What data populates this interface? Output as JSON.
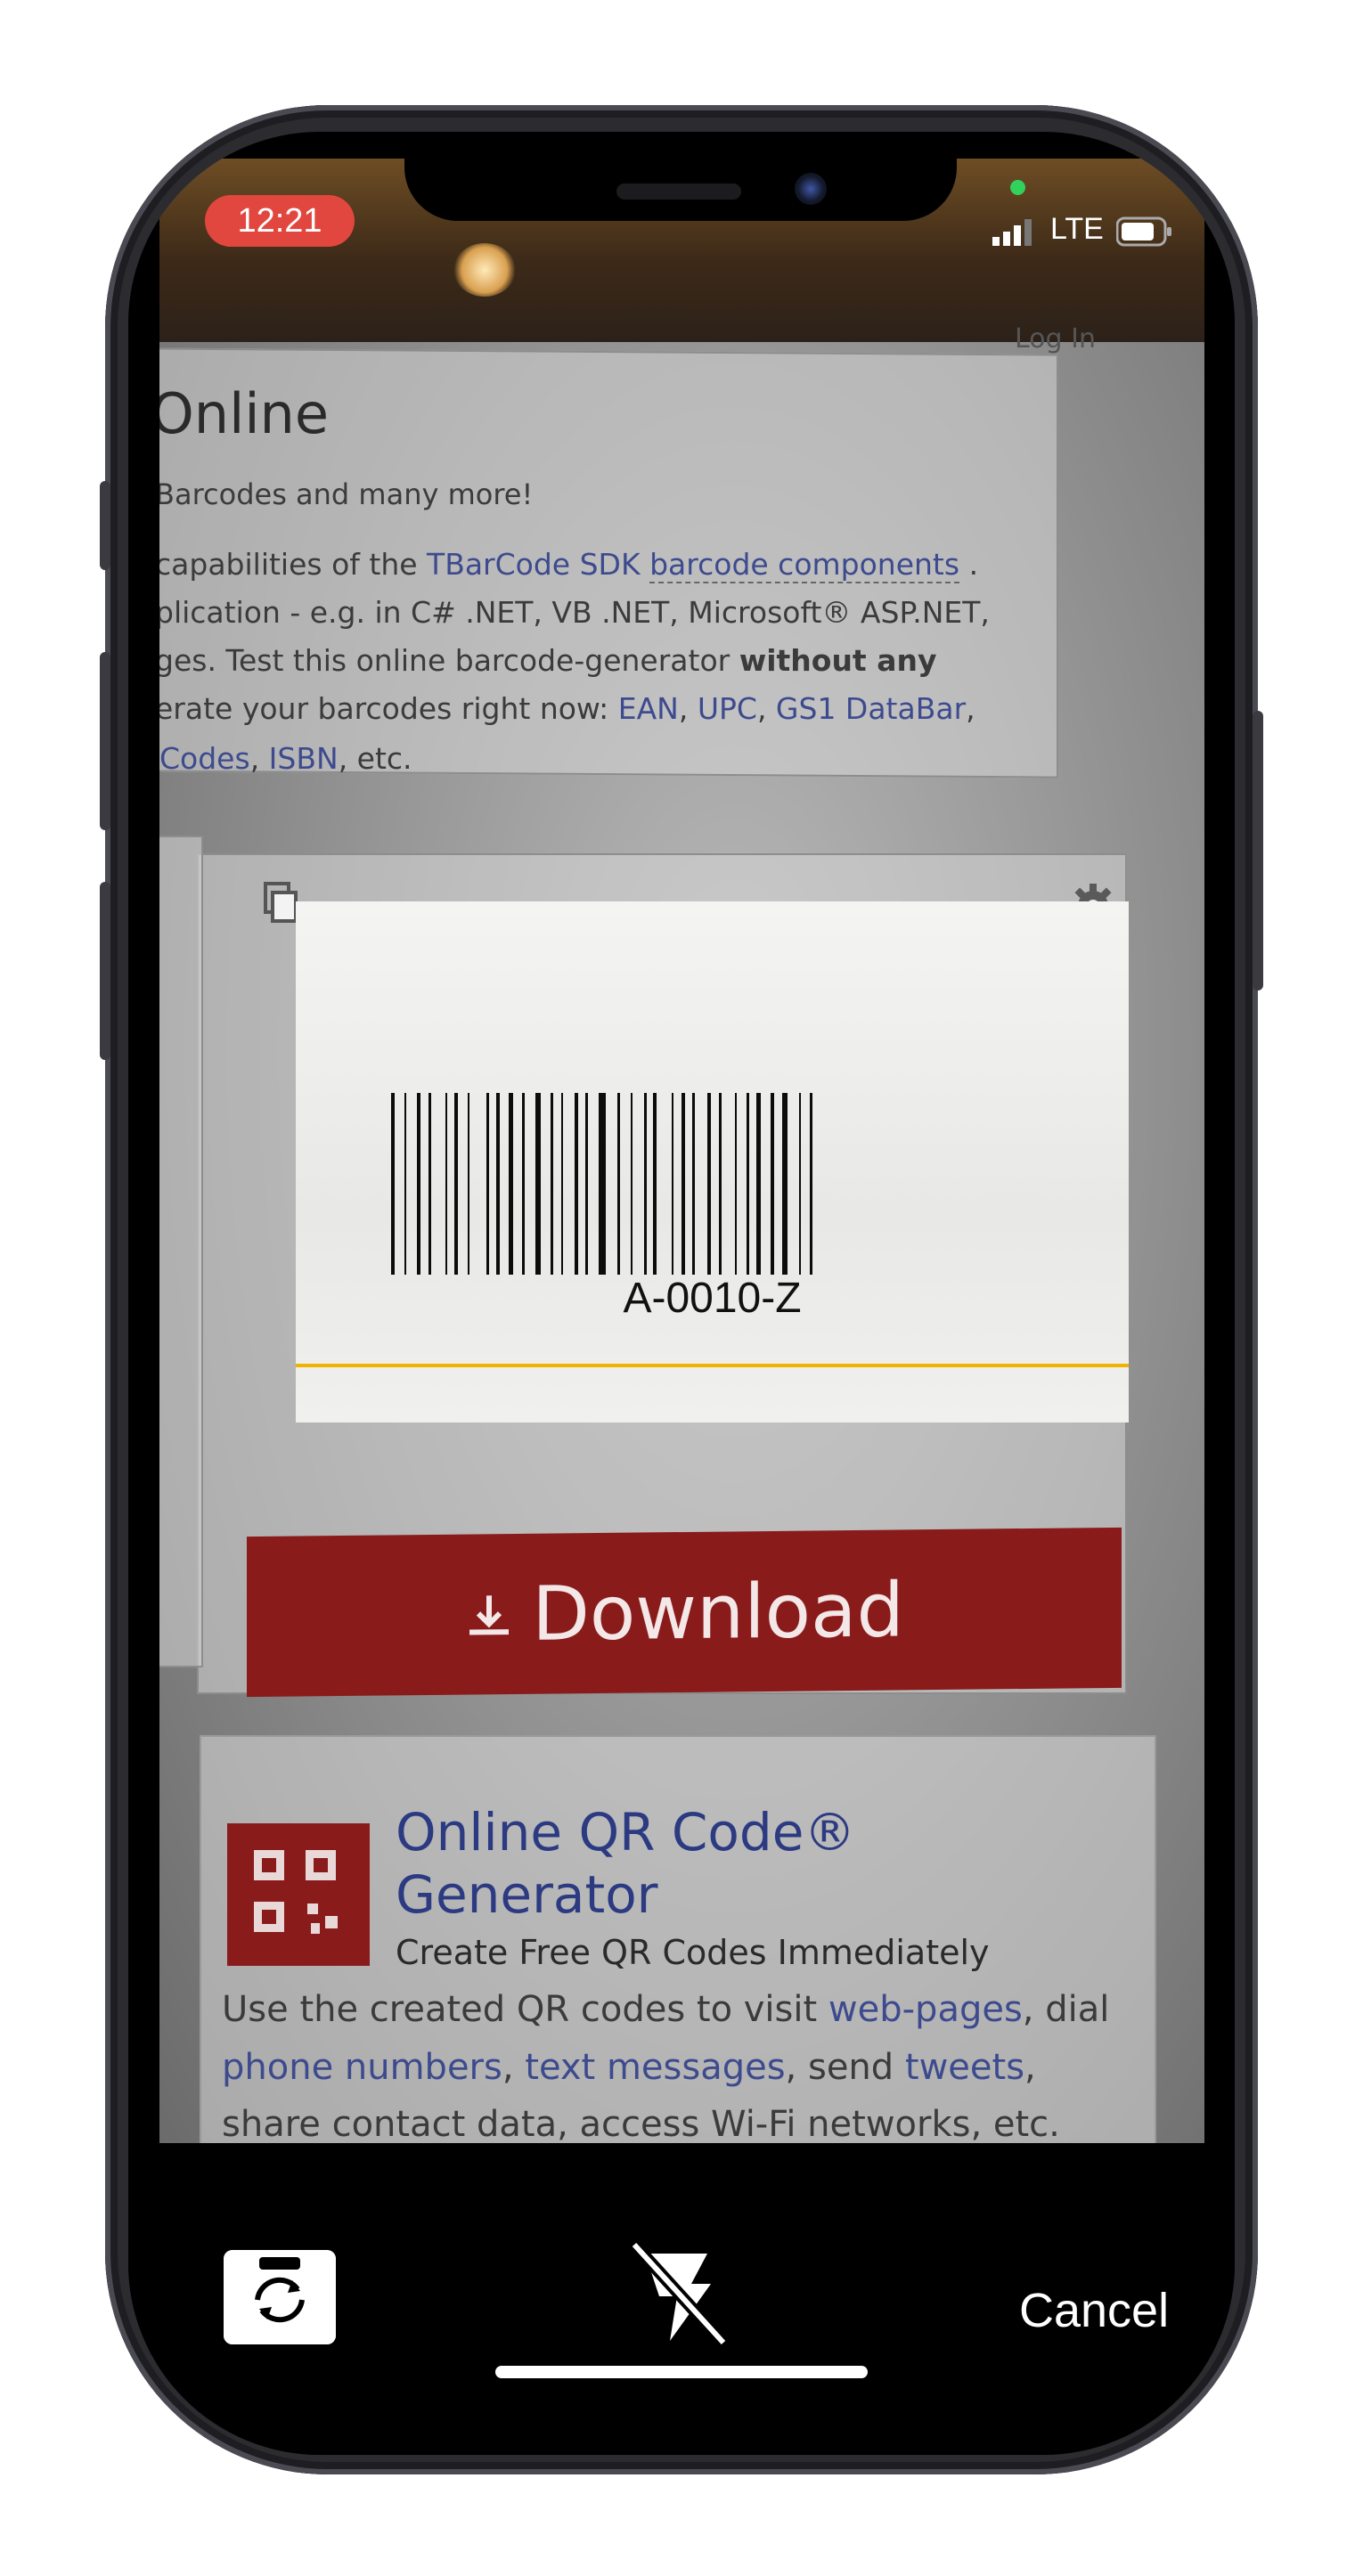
{
  "status_bar": {
    "time": "12:21",
    "network": "LTE"
  },
  "background_page": {
    "login": "Log In",
    "heading": "Online",
    "subheading": "Barcodes and many more!",
    "para_line1_a": "capabilities of the ",
    "para_line1_link1": "TBarCode SDK",
    "para_line1_link2": "barcode components",
    "para_line1_b": ".",
    "para_line2": "plication - e.g. in C# .NET, VB .NET, Microsoft® ASP.NET,",
    "para_line3_a": "ges. Test this online barcode-generator ",
    "para_line3_b": "without any",
    "para_line4_a": "erate your barcodes right now: ",
    "para_line4_link1": "EAN",
    "para_line4_link2": "UPC",
    "para_line4_link3": "GS1 DataBar",
    "para_line5_link1": "Codes",
    "para_line5_link2": "ISBN",
    "para_line5_b": ", etc.",
    "download_label": "Download",
    "qr_title_line1": "Online QR Code®",
    "qr_title_line2": "Generator",
    "qr_subtitle": "Create Free QR Codes Immediately",
    "qr_body1_a": "Use the created QR codes to visit ",
    "qr_body1_link": "web-pages",
    "qr_body1_b": ", dial",
    "qr_body2_link1": "phone numbers",
    "qr_body2_link2": "text messages",
    "qr_body2_b": ", send ",
    "qr_body2_link3": "tweets",
    "qr_body2_c": ",",
    "qr_body3": "share contact data, access Wi-Fi networks, etc."
  },
  "scan": {
    "barcode_text": "A-0010-Z"
  },
  "controls": {
    "cancel_label": "Cancel",
    "flip_camera_icon": "camera-rotate-icon",
    "flash_off_icon": "flash-off-icon"
  },
  "colors": {
    "time_pill": "#e1473e",
    "download_button": "#8a1b1b",
    "scan_line": "#f0b400"
  }
}
